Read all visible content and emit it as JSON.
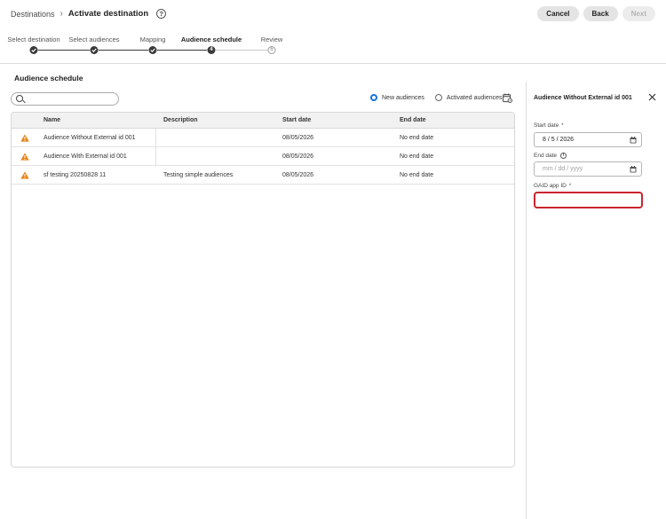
{
  "breadcrumb": {
    "parent": "Destinations",
    "separator": "›",
    "current": "Activate destination",
    "help_glyph": "?"
  },
  "actions": {
    "cancel": "Cancel",
    "back": "Back",
    "next": "Next"
  },
  "steps": [
    {
      "label": "Select destination",
      "state": "done"
    },
    {
      "label": "Select audiences",
      "state": "done"
    },
    {
      "label": "Mapping",
      "state": "done"
    },
    {
      "label": "Audience schedule",
      "state": "current",
      "number": "4"
    },
    {
      "label": "Review",
      "state": "pending",
      "number": "5"
    }
  ],
  "section_title": "Audience schedule",
  "search": {
    "value": "",
    "placeholder": ""
  },
  "view_options": {
    "new_audiences": "New audiences",
    "activated_audiences": "Activated audiences",
    "selected": "new_audiences"
  },
  "table": {
    "columns": [
      "Name",
      "Description",
      "Start date",
      "End date"
    ],
    "rows": [
      {
        "name": "Audience Without External id 001",
        "description": "",
        "start": "08/05/2026",
        "end": "No end date",
        "status_icon": "warning-icon"
      },
      {
        "name": "Audience With External id 001",
        "description": "",
        "start": "08/05/2026",
        "end": "No end date",
        "status_icon": "warning-icon"
      },
      {
        "name": "sf testing 20250828 11",
        "description": "Testing simple audiences",
        "start": "08/05/2026",
        "end": "No end date",
        "status_icon": "warning-icon"
      }
    ]
  },
  "panel": {
    "title": "Audience Without External id 001",
    "start_label": "Start date",
    "start_value": "8 / 5 / 2026",
    "end_label": "End date",
    "end_placeholder": "mm / dd / yyyy",
    "gaid_label": "GAID app ID",
    "gaid_value": "",
    "required_mark": "*",
    "info_glyph": "i"
  },
  "colors": {
    "accent": "#1473e6",
    "error": "#c9252d",
    "warning": "#e68619"
  }
}
